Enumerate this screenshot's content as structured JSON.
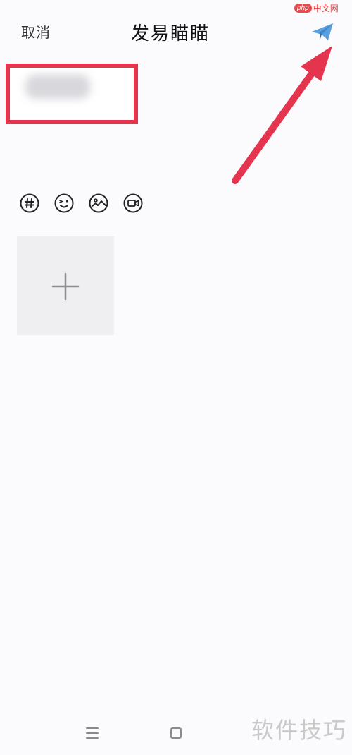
{
  "header": {
    "cancel_label": "取消",
    "title": "发易瞄瞄"
  },
  "icons": {
    "send": "paper-plane-icon",
    "topic": "hashtag-icon",
    "emoji": "emoji-icon",
    "image": "image-icon",
    "video": "video-icon",
    "add": "plus-icon",
    "nav_menu": "menu-icon",
    "nav_home": "home-square-icon"
  },
  "watermarks": {
    "top_badge": "php",
    "top_text": "中文网",
    "bottom_text": "软件技巧"
  },
  "colors": {
    "highlight": "#e4344e",
    "arrow": "#e4344e",
    "send_icon": "#5aa0e0",
    "tile": "#efeff2"
  }
}
